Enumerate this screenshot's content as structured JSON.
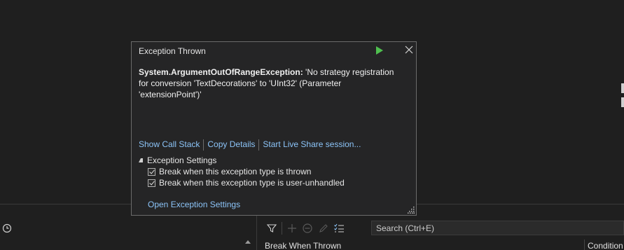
{
  "popup": {
    "title": "Exception Thrown",
    "exception_type": "System.ArgumentOutOfRangeException:",
    "message_lines": [
      "'No strategy registration",
      "for conversion 'TextDecorations' to 'UInt32' (Parameter",
      "'extensionPoint')'"
    ],
    "links": {
      "show_call_stack": "Show Call Stack",
      "copy_details": "Copy Details",
      "live_share": "Start Live Share session..."
    },
    "settings": {
      "header": "Exception Settings",
      "break_thrown": "Break when this exception type is thrown",
      "break_unhandled": "Break when this exception type is user-unhandled",
      "break_thrown_checked": true,
      "break_unhandled_checked": true
    },
    "open_settings": "Open Exception Settings"
  },
  "exception_settings_pane": {
    "search_placeholder": "Search (Ctrl+E)",
    "col_break_when_thrown": "Break When Thrown",
    "col_conditions": "Condition"
  },
  "colors": {
    "link": "#8cc4f8",
    "play_green": "#4fc04f",
    "background": "#1f1f1f",
    "popup_bg": "#252526"
  }
}
